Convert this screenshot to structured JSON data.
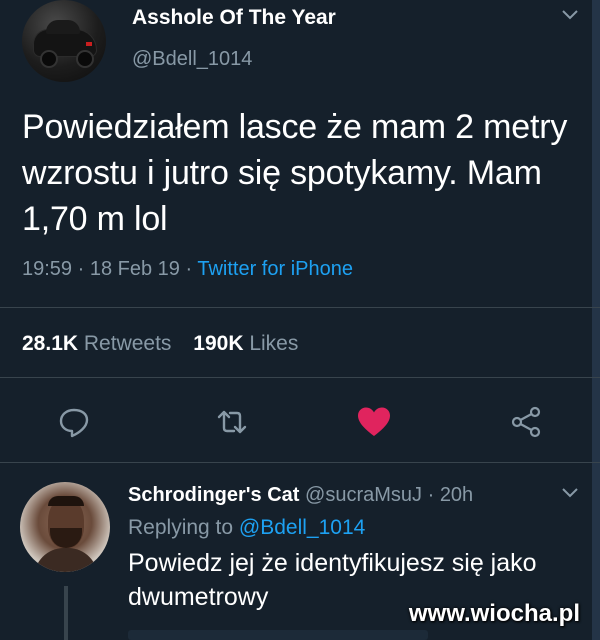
{
  "tweet": {
    "display_name": "Asshole Of The Year",
    "handle": "@Bdell_1014",
    "text": "Powiedziałem lasce że mam 2 metry wzrostu i jutro się spotykamy. Mam 1,70 m lol",
    "time": "19:59",
    "sep1": " · ",
    "date": "18 Feb 19",
    "sep2": " · ",
    "source": "Twitter for iPhone",
    "retweets_count": "28.1K",
    "retweets_label": "Retweets",
    "likes_count": "190K",
    "likes_label": "Likes"
  },
  "reply": {
    "display_name": "Schrodinger's Cat",
    "handle": "@sucraMsuJ",
    "sep": " · ",
    "age": "20h",
    "replying_prefix": "Replying to ",
    "replying_handle": "@Bdell_1014",
    "text": "Powiedz jej że identyfikujesz się jako dwumetrowy"
  },
  "watermark": "www.wiocha.pl",
  "icons": [
    "chevron-down-icon",
    "reply-icon",
    "retweet-icon",
    "heart-icon",
    "share-icon"
  ],
  "colors": {
    "background": "#15202b",
    "link": "#1da1f2",
    "muted": "#8899a6",
    "like": "#e0245e"
  }
}
